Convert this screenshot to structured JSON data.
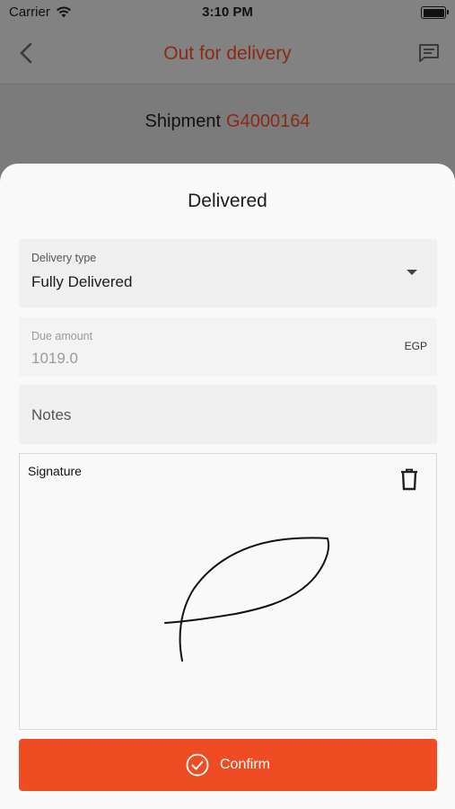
{
  "status_bar": {
    "carrier": "Carrier",
    "time": "3:10 PM",
    "icons": [
      "wifi-icon",
      "battery-icon"
    ]
  },
  "nav": {
    "title": "Out for delivery",
    "back_icon": "chevron-left-icon",
    "chat_icon": "chat-icon"
  },
  "shipment": {
    "label": "Shipment",
    "number": "G4000164"
  },
  "sheet": {
    "title": "Delivered",
    "delivery_type": {
      "label": "Delivery type",
      "value": "Fully Delivered"
    },
    "due_amount": {
      "label": "Due amount",
      "value": "1019.0",
      "currency": "EGP"
    },
    "notes": {
      "placeholder": "Notes"
    },
    "signature": {
      "label": "Signature",
      "clear_icon": "trash-icon"
    },
    "confirm": {
      "label": "Confirm",
      "icon": "check-circle-icon"
    }
  },
  "colors": {
    "accent": "#ef4c23",
    "title_red": "#8a2a14",
    "overlay": "#828282"
  }
}
